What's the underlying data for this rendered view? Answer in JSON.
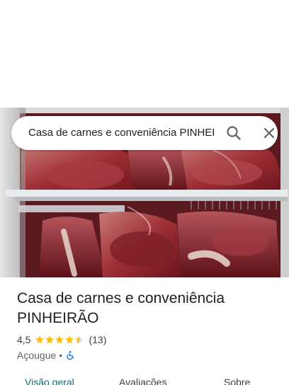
{
  "search": {
    "query": "Casa de carnes e conveniência PINHEIRÃO",
    "search_icon": "search-icon",
    "close_icon": "close-icon"
  },
  "hero": {
    "photo": "meat-display-fridge-photo"
  },
  "place": {
    "name": "Casa de carnes e conveniência PINHEIRÃO",
    "rating": "4,5",
    "rating_value": 4.5,
    "review_count": "(13)",
    "category": "Açougue",
    "separator": "•",
    "accessibility_icon": "wheelchair-icon"
  },
  "tabs": [
    {
      "label": "Visão geral",
      "active": true
    },
    {
      "label": "Avaliações",
      "active": false
    },
    {
      "label": "Sobre",
      "active": false
    }
  ],
  "colors": {
    "accent": "#0b6b78",
    "star": "#fbbc04",
    "accessibility": "#1a73e8"
  }
}
